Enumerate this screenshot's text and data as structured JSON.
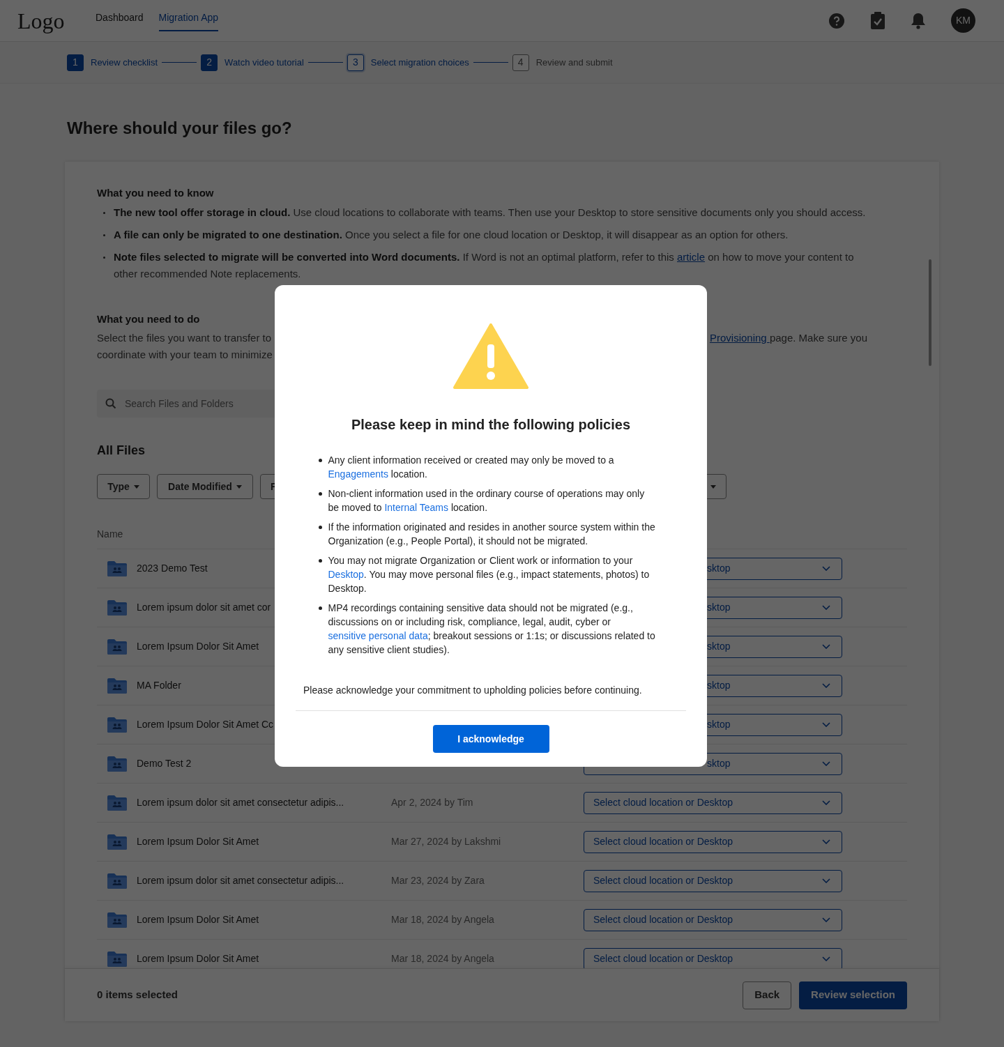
{
  "header": {
    "logo": "Logo",
    "nav": [
      {
        "label": "Dashboard",
        "selected": false
      },
      {
        "label": "Migration App",
        "selected": true
      }
    ],
    "avatar": "KM"
  },
  "steps": [
    {
      "number": "1",
      "label": "Review checklist",
      "completed": true,
      "selected": false
    },
    {
      "number": "2",
      "label": "Watch video tutorial",
      "completed": true,
      "selected": false
    },
    {
      "number": "3",
      "label": "Select migration choices",
      "completed": false,
      "selected": true
    },
    {
      "number": "4",
      "label": "Review and submit",
      "completed": false,
      "selected": false
    }
  ],
  "page_title": "Where should your files go?",
  "know": {
    "heading": "What you need to know",
    "items": [
      [
        {
          "bold": "The new tool offer storage in cloud."
        },
        {
          "text": " Use cloud locations to collaborate with teams. Then use your Desktop to store sensitive documents only you should access."
        }
      ],
      [
        {
          "bold": "A file can only be migrated to one destination."
        },
        {
          "text": " Once you select a file for one cloud location or Desktop, it will disappear as an option for others."
        }
      ],
      [
        {
          "bold": "Note files selected to migrate will be converted into Word documents."
        },
        {
          "text": " If Word is not an optimal platform, refer to this "
        },
        {
          "link": "article"
        },
        {
          "text": " on how to move your content to other recommended Note replacements."
        }
      ]
    ]
  },
  "todo": {
    "heading": "What you need to do",
    "left_lines": [
      "Select the files you want to transfer to",
      "coordinate with your team to minimize"
    ],
    "link": "Provisioning ",
    "right_text": "page. Make sure you"
  },
  "search": {
    "placeholder": "Search Files and Folders"
  },
  "files_title": "All Files",
  "filters": [
    {
      "kind": "labeled",
      "label": "Type"
    },
    {
      "kind": "labeled",
      "label": "Date Modified"
    },
    {
      "kind": "labeled",
      "label": "F"
    },
    {
      "kind": "caret-only"
    }
  ],
  "columns": [
    "Name"
  ],
  "rows": [
    {
      "kind": "covered",
      "name": "2023 Demo Test",
      "location": "sktop"
    },
    {
      "kind": "covered",
      "name": "Lorem ipsum dolor sit amet cor",
      "location": "sktop"
    },
    {
      "kind": "covered",
      "name": "Lorem Ipsum Dolor Sit Amet",
      "location": "sktop"
    },
    {
      "kind": "covered",
      "name": "MA Folder",
      "location": "sktop"
    },
    {
      "kind": "covered",
      "name": "Lorem Ipsum Dolor Sit Amet Cc",
      "location": "sktop"
    },
    {
      "kind": "covered",
      "name": "Demo Test 2",
      "location": "sktop"
    },
    {
      "kind": "visible",
      "name": "Lorem ipsum dolor sit amet consectetur adipis...",
      "date": "Apr 2, 2024 by Tim",
      "location": "Select cloud location or Desktop"
    },
    {
      "kind": "visible",
      "name": "Lorem Ipsum Dolor Sit Amet",
      "date": "Mar 27, 2024 by Lakshmi",
      "location": "Select cloud location or Desktop"
    },
    {
      "kind": "visible",
      "name": "Lorem ipsum dolor sit amet consectetur adipis...",
      "date": "Mar 23, 2024 by Zara",
      "location": "Select cloud location or Desktop"
    },
    {
      "kind": "visible",
      "name": "Lorem Ipsum Dolor Sit Amet",
      "date": "Mar 18, 2024 by Angela",
      "location": "Select cloud location or Desktop"
    },
    {
      "kind": "visible",
      "name": "Lorem Ipsum Dolor Sit Amet",
      "date": "Mar 18, 2024 by Angela",
      "location": "Select cloud location or Desktop"
    }
  ],
  "footer": {
    "count": "0 items selected",
    "back": "Back",
    "review": "Review selection"
  },
  "modal": {
    "title": "Please keep in mind the following policies",
    "policies": [
      [
        {
          "text": "Any client information received or created may only be moved to a "
        },
        {
          "link": "Engagements"
        },
        {
          "text": " location."
        }
      ],
      [
        {
          "text": "Non-client information used in the ordinary course of operations may only be moved to "
        },
        {
          "link": "Internal Teams"
        },
        {
          "text": " location."
        }
      ],
      [
        {
          "text": "If the information originated and resides in another source system within the Organization (e.g., People Portal), it should not be migrated."
        }
      ],
      [
        {
          "text": "You may not migrate Organization or Client work or information to your "
        },
        {
          "link": "Desktop"
        },
        {
          "text": ". You may move personal files (e.g., impact statements, photos) to Desktop."
        }
      ],
      [
        {
          "text": "MP4 recordings containing sensitive data should not be migrated (e.g., discussions on or including risk, compliance, legal, audit, cyber or "
        },
        {
          "link": "sensitive personal data"
        },
        {
          "text": "; breakout sessions or 1:1s; or discussions related to any sensitive client studies)."
        }
      ]
    ],
    "acknowledge_text": "Please acknowledge your commitment to upholding policies before continuing.",
    "button": "I acknowledge"
  }
}
